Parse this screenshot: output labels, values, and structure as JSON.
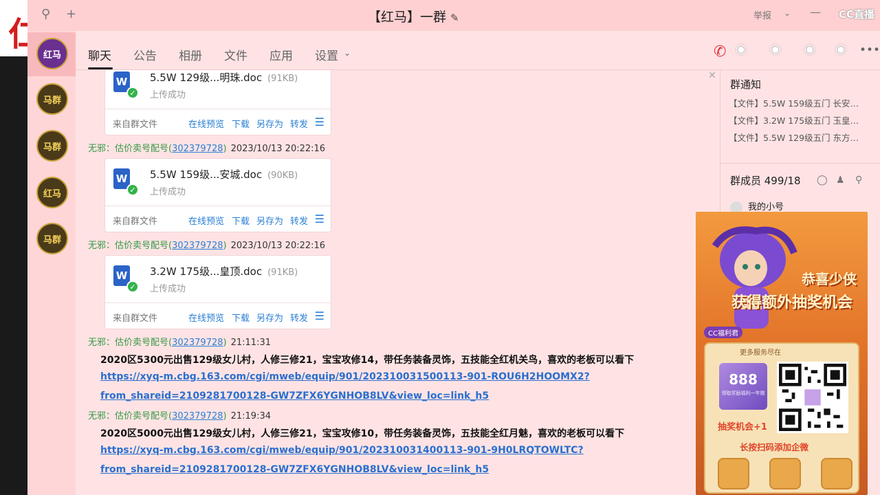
{
  "window": {
    "title": "【红马】一群",
    "report_label": "举报",
    "brand": "CC直播"
  },
  "background": {
    "left_glyph": "仁"
  },
  "sidebar": {
    "items": [
      {
        "label": "红马",
        "active": true
      },
      {
        "label": "马群"
      },
      {
        "label": "马群"
      },
      {
        "label": "红马"
      },
      {
        "label": "马群"
      }
    ]
  },
  "tabs": [
    {
      "label": "聊天",
      "active": true
    },
    {
      "label": "公告"
    },
    {
      "label": "相册"
    },
    {
      "label": "文件"
    },
    {
      "label": "应用"
    },
    {
      "label": "设置"
    }
  ],
  "chat": {
    "file_cards": [
      {
        "name": "5.5W  129级...明珠.doc",
        "size": "(91KB)",
        "status": "上传成功",
        "source": "来自群文件"
      },
      {
        "name": "5.5W  159级...安城.doc",
        "size": "(90KB)",
        "status": "上传成功",
        "source": "来自群文件"
      },
      {
        "name": "3.2W  175级...皇顶.doc",
        "size": "(91KB)",
        "status": "上传成功",
        "source": "来自群文件"
      }
    ],
    "file_actions": [
      "在线预览",
      "下载",
      "另存为",
      "转发"
    ],
    "senders": [
      {
        "name": "无邪：估价卖号配号(",
        "qq": "302379728",
        "close": ")",
        "time": "2023/10/13 20:22:16"
      },
      {
        "name": "无邪：估价卖号配号(",
        "qq": "302379728",
        "close": ")",
        "time": "2023/10/13 20:22:16"
      },
      {
        "name": "无邪：估价卖号配号(",
        "qq": "302379728",
        "close": ")",
        "time": "21:11:31"
      },
      {
        "name": "无邪：估价卖号配号(",
        "qq": "302379728",
        "close": ")",
        "time": "21:19:34"
      }
    ],
    "messages": [
      {
        "text": "2020区5300元出售129级女儿村，人修三修21，宝宝攻修14，带任务装备灵饰，五技能全红机关鸟，喜欢的老板可以看下",
        "link1": "https://xyq-m.cbg.163.com/cgi/mweb/equip/901/202310031500113-901-ROU6H2HOOMX2?",
        "link2": "from_shareid=2109281700128-GW7ZFX6YGNHOB8LV&view_loc=link_h5"
      },
      {
        "text": "2020区5000元出售129级女儿村，人修三修21，宝宝攻修10，带任务装备灵饰，五技能全红月魅，喜欢的老板可以看下",
        "link1": "https://xyq-m.cbg.163.com/cgi/mweb/equip/901/202310031400113-901-9H0LRQTOWLTC?",
        "link2": "from_shareid=2109281700128-GW7ZFX6YGNHOB8LV&view_loc=link_h5"
      }
    ]
  },
  "right_panel": {
    "notice_title": "群通知",
    "notices": [
      "【文件】5.5W  159级五门 长安…",
      "【文件】3.2W  175级五门 玉皇…",
      "【文件】5.5W  129级五门 东方…"
    ],
    "members_title": "群成员 499/18",
    "member": "我的小号"
  },
  "ad": {
    "headline1": "恭喜少侠",
    "headline2": "获得额外抽奖机会",
    "cc_tag": "CC福利君",
    "panel_head": "更多服务尽在",
    "badge_num": "888",
    "badge_sub": "领取奖励福利一年赠",
    "lottery": "抽奖机会+1",
    "scan": "长按扫码添加企微"
  }
}
